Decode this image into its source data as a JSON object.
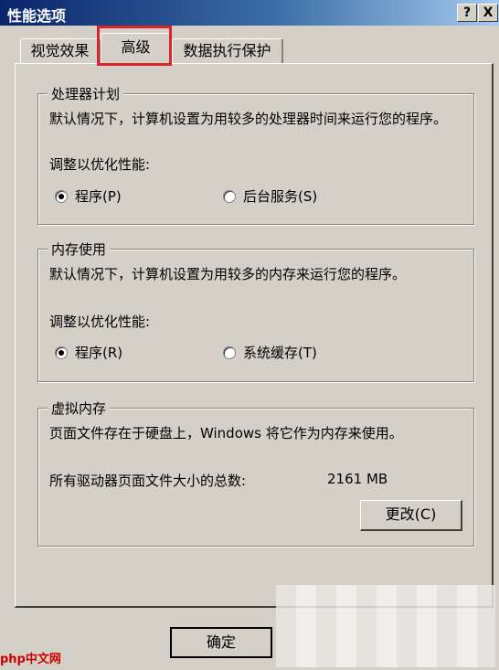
{
  "window": {
    "title": "性能选项",
    "help_label": "?",
    "close_label": "X"
  },
  "tabs": [
    {
      "label": "视觉效果"
    },
    {
      "label": "高级"
    },
    {
      "label": "数据执行保护"
    }
  ],
  "processor": {
    "legend": "处理器计划",
    "description": "默认情况下，计算机设置为用较多的处理器时间来运行您的程序。",
    "adjust_label": "调整以优化性能:",
    "options": [
      {
        "label": "程序(P)",
        "checked": true
      },
      {
        "label": "后台服务(S)",
        "checked": false
      }
    ]
  },
  "memory": {
    "legend": "内存使用",
    "description": "默认情况下，计算机设置为用较多的内存来运行您的程序。",
    "adjust_label": "调整以优化性能:",
    "options": [
      {
        "label": "程序(R)",
        "checked": true
      },
      {
        "label": "系统缓存(T)",
        "checked": false
      }
    ]
  },
  "virtual_memory": {
    "legend": "虚拟内存",
    "description": "页面文件存在于硬盘上，Windows 将它作为内存来使用。",
    "total_label": "所有驱动器页面文件大小的总数:",
    "total_value": "2161 MB",
    "change_button": "更改(C)"
  },
  "footer": {
    "ok_button": "确定"
  },
  "watermark": "php中文网",
  "colors": {
    "titlebar_start": "#0a246a",
    "face": "#d4d0c8",
    "highlight_box": "#d8262d"
  }
}
